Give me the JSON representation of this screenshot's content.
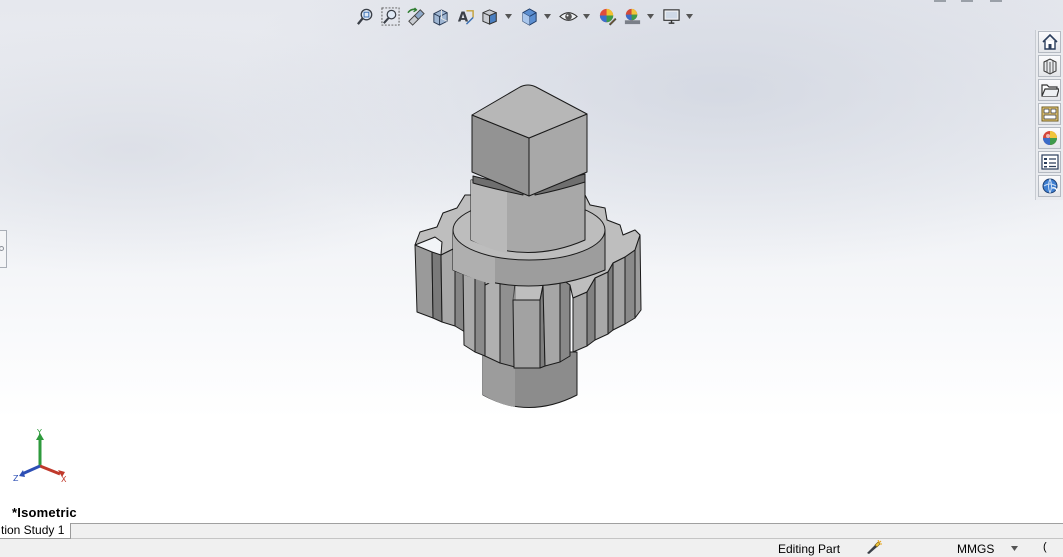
{
  "viewport": {
    "view_name": "*Isometric",
    "triad": {
      "x_label": "X",
      "y_label": "Y",
      "z_label": "Z"
    },
    "hud_toolbar": [
      {
        "name": "zoom-to-fit-icon",
        "has_menu": false
      },
      {
        "name": "zoom-to-area-icon",
        "has_menu": false
      },
      {
        "name": "previous-view-icon",
        "has_menu": false
      },
      {
        "name": "section-view-icon",
        "has_menu": false
      },
      {
        "name": "dynamic-annotation-views-icon",
        "has_menu": false
      },
      {
        "name": "view-orientation-icon",
        "has_menu": true
      },
      {
        "name": "display-style-icon",
        "has_menu": true
      },
      {
        "name": "hide-show-items-icon",
        "has_menu": true
      },
      {
        "name": "edit-appearance-icon",
        "has_menu": false
      },
      {
        "name": "apply-scene-icon",
        "has_menu": true
      },
      {
        "name": "view-settings-icon",
        "has_menu": true
      }
    ],
    "task_pane": [
      "solidworks-resources-icon",
      "design-library-icon",
      "file-explorer-icon",
      "view-palette-icon",
      "appearances-scenes-icon",
      "custom-properties-icon",
      "solidworks-forum-icon"
    ],
    "colors": {
      "model_face": "#9a9a9a",
      "model_light": "#bdbdbd",
      "model_dark": "#6e6e6e",
      "edge": "#1a1a1a"
    }
  },
  "tabs": {
    "motion_study": "tion Study 1"
  },
  "status_bar": {
    "editing": "Editing Part",
    "units": "MMGS",
    "extra": "("
  }
}
